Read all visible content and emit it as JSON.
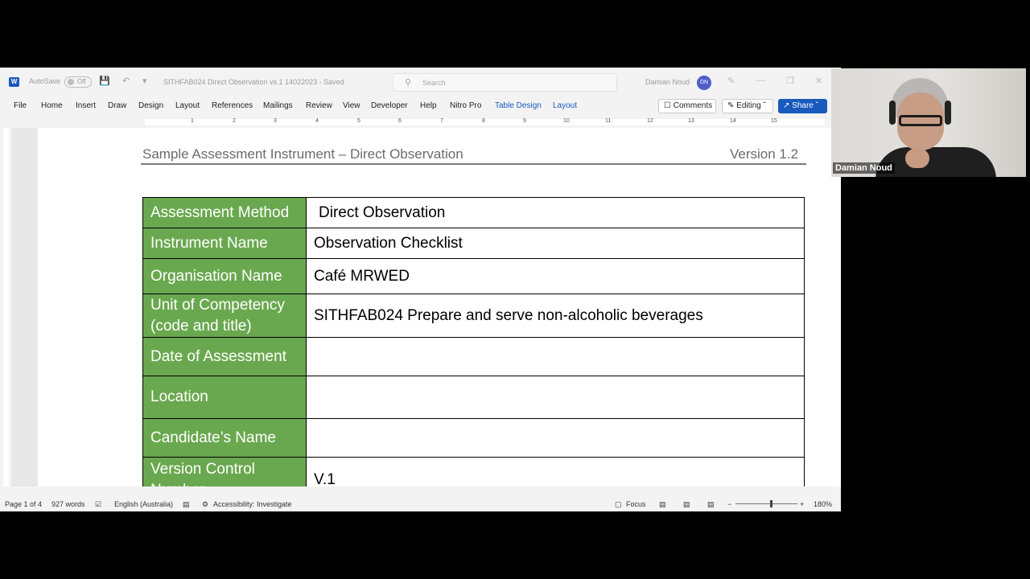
{
  "titlebar": {
    "autosave_label": "AutoSave",
    "autosave_state": "Off",
    "document_title": "SITHFAB024 Direct Observation vs.1 14022023 - Saved",
    "search_placeholder": "Search",
    "user_name": "Damian Noud",
    "user_initials": "DN"
  },
  "ribbon": {
    "tabs": [
      "File",
      "Home",
      "Insert",
      "Draw",
      "Design",
      "Layout",
      "References",
      "Mailings",
      "Review",
      "View",
      "Developer",
      "Help",
      "Nitro Pro",
      "Table Design",
      "Layout"
    ],
    "comments_label": "Comments",
    "editing_label": "Editing",
    "share_label": "Share"
  },
  "ruler_numbers": [
    "1",
    "2",
    "3",
    "4",
    "5",
    "6",
    "7",
    "8",
    "9",
    "10",
    "11",
    "12",
    "13",
    "14",
    "15"
  ],
  "document": {
    "header_title": "Sample Assessment Instrument – Direct Observation",
    "header_version": "Version 1.2",
    "rows": [
      {
        "label": "Assessment Method",
        "value": "Direct Observation"
      },
      {
        "label": "Instrument Name",
        "value": "Observation Checklist"
      },
      {
        "label": "Organisation Name",
        "value": "Café MRWED"
      },
      {
        "label": "Unit of Competency (code and title)",
        "value": "SITHFAB024 Prepare and serve non-alcoholic beverages"
      },
      {
        "label": "Date of Assessment",
        "value": ""
      },
      {
        "label": "Location",
        "value": ""
      },
      {
        "label": "Candidate’s Name",
        "value": ""
      },
      {
        "label": "Version Control Number",
        "value": "V.1"
      }
    ]
  },
  "statusbar": {
    "page": "Page 1 of 4",
    "words": "927 words",
    "language": "English (Australia)",
    "accessibility": "Accessibility: Investigate",
    "focus": "Focus",
    "zoom": "180%"
  },
  "webcam": {
    "participant_name": "Damian Noud"
  },
  "colors": {
    "label_cell_bg": "#6aa84f",
    "word_blue": "#185abd"
  }
}
